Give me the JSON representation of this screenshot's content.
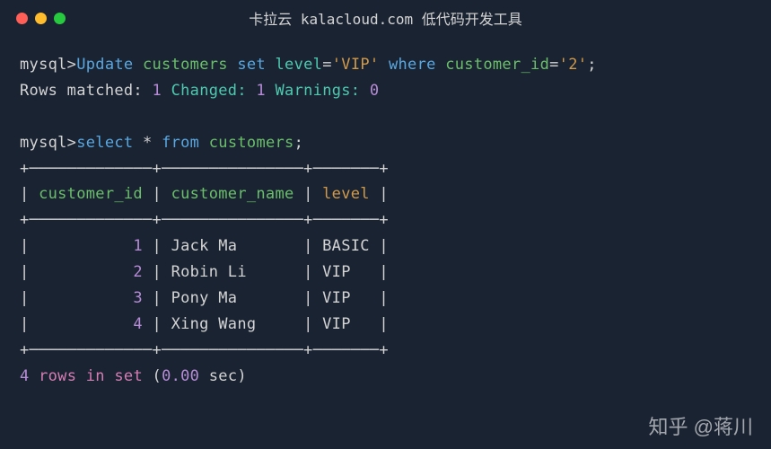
{
  "titlebar": {
    "title": "卡拉云 kalacloud.com 低代码开发工具"
  },
  "line1": {
    "prompt": "mysql>",
    "update": "Update",
    "table": "customers",
    "set": "set",
    "col": "level",
    "eq1": "=",
    "val1": "'VIP'",
    "where": "where",
    "col2": "customer_id",
    "eq2": "=",
    "val2": "'2'",
    "semi": ";"
  },
  "line2": {
    "matched_label": "Rows matched:",
    "matched_val": "1",
    "changed_label": "Changed:",
    "changed_val": "1",
    "warnings_label": "Warnings:",
    "warnings_val": "0"
  },
  "line3": {
    "prompt": "mysql>",
    "select": "select",
    "star": "*",
    "from": "from",
    "table": "customers",
    "semi": ";"
  },
  "table": {
    "border_top": "+─────────────+───────────────+───────+",
    "header_pipe1": "| ",
    "header_col1": "customer_id",
    "header_pipe2": " | ",
    "header_col2": "customer_name",
    "header_pipe3": " | ",
    "header_col3": "level",
    "header_pipe4": " |",
    "border_mid": "+─────────────+───────────────+───────+",
    "rows": [
      {
        "p1": "|           ",
        "id": "1",
        "p2": " | ",
        "name": "Jack Ma      ",
        "p3": " | ",
        "level": "BASIC",
        "p4": " |"
      },
      {
        "p1": "|           ",
        "id": "2",
        "p2": " | ",
        "name": "Robin Li     ",
        "p3": " | ",
        "level": "VIP  ",
        "p4": " |"
      },
      {
        "p1": "|           ",
        "id": "3",
        "p2": " | ",
        "name": "Pony Ma      ",
        "p3": " | ",
        "level": "VIP  ",
        "p4": " |"
      },
      {
        "p1": "|           ",
        "id": "4",
        "p2": " | ",
        "name": "Xing Wang    ",
        "p3": " | ",
        "level": "VIP  ",
        "p4": " |"
      }
    ],
    "border_bot": "+─────────────+───────────────+───────+"
  },
  "footer": {
    "count": "4",
    "rows_in_set": "rows in set",
    "paren_open": "(",
    "time": "0.00",
    "sec": " sec)",
    "watermark": "知乎 @蒋川"
  }
}
